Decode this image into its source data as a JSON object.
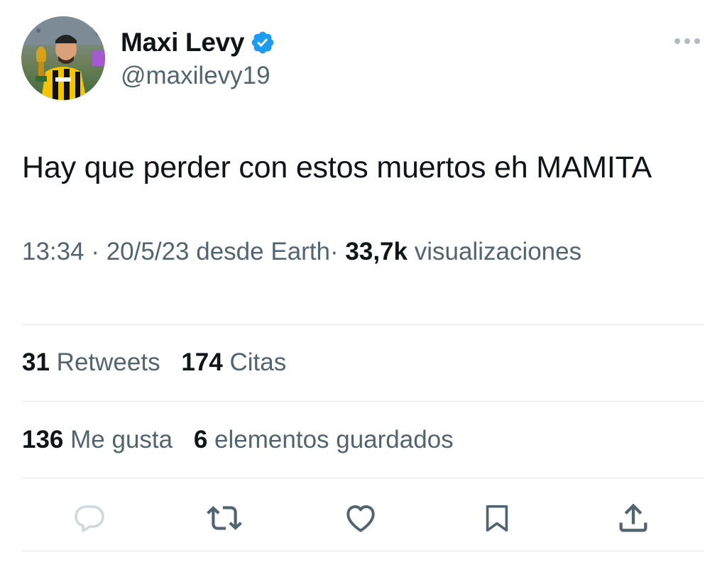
{
  "author": {
    "name": "Maxi Levy",
    "handle": "@maxilevy19",
    "verified_icon": "verified-badge-icon",
    "avatar_icon": "avatar-photo"
  },
  "tweet": {
    "text": "Hay que perder con estos muertos eh MAMITA",
    "time": "13:34",
    "date": "20/5/23",
    "source_prefix": "desde",
    "source": "Earth",
    "separator": "·",
    "views_count": "33,7k",
    "views_label": "visualizaciones"
  },
  "stats": {
    "retweets_count": "31",
    "retweets_label": "Retweets",
    "quotes_count": "174",
    "quotes_label": "Citas",
    "likes_count": "136",
    "likes_label": "Me gusta",
    "bookmarks_count": "6",
    "bookmarks_label": "elementos guardados"
  },
  "actions": {
    "reply_icon": "reply-icon",
    "retweet_icon": "retweet-icon",
    "like_icon": "heart-icon",
    "bookmark_icon": "bookmark-icon",
    "share_icon": "share-icon",
    "more_icon": "more-options-icon"
  },
  "colors": {
    "text_primary": "#0f1419",
    "text_secondary": "#536471",
    "verified_blue": "#1d9bf0",
    "divider": "#e4e8eb",
    "reply_disabled": "#cfd9de"
  }
}
